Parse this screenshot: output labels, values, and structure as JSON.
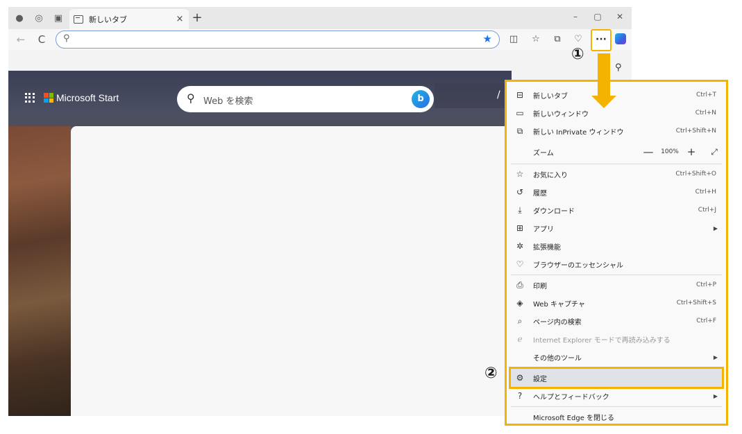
{
  "tab": {
    "label": "新しいタブ",
    "close": "×"
  },
  "tabbar": {
    "new_tab": "+",
    "minimize": "–",
    "restore": "▢",
    "close": "✕"
  },
  "toolbar": {
    "back": "←",
    "refresh": "C",
    "search_glyph": "⚲",
    "favorite_glyph": "★",
    "more_label": "···"
  },
  "content": {
    "brand_title": "Microsoft Start",
    "search_placeholder": "Web を検索",
    "bing_label": "b",
    "slash": "/"
  },
  "ms_colors": [
    "#f25022",
    "#7fba00",
    "#00a4ef",
    "#ffb900"
  ],
  "menu": {
    "new_tab": {
      "label": "新しいタブ",
      "shortcut": "Ctrl+T"
    },
    "new_window": {
      "label": "新しいウィンドウ",
      "shortcut": "Ctrl+N"
    },
    "new_inprivate": {
      "label": "新しい InPrivate ウィンドウ",
      "shortcut": "Ctrl+Shift+N"
    },
    "zoom": {
      "label": "ズーム",
      "minus": "—",
      "value": "100%",
      "plus": "+",
      "fullscreen": "⤢"
    },
    "favorites": {
      "label": "お気に入り",
      "shortcut": "Ctrl+Shift+O"
    },
    "history": {
      "label": "履歴",
      "shortcut": "Ctrl+H"
    },
    "downloads": {
      "label": "ダウンロード",
      "shortcut": "Ctrl+J"
    },
    "apps": {
      "label": "アプリ",
      "arrow": "▶"
    },
    "extensions": {
      "label": "拡張機能"
    },
    "essentials": {
      "label": "ブラウザーのエッセンシャル"
    },
    "print": {
      "label": "印刷",
      "shortcut": "Ctrl+P"
    },
    "web_capture": {
      "label": "Web キャプチャ",
      "shortcut": "Ctrl+Shift+S"
    },
    "find": {
      "label": "ページ内の検索",
      "shortcut": "Ctrl+F"
    },
    "ie_mode": {
      "label": "Internet Explorer モードで再読み込みする"
    },
    "more_tools": {
      "label": "その他のツール",
      "arrow": "▶"
    },
    "settings": {
      "label": "設定"
    },
    "help": {
      "label": "ヘルプとフィードバック",
      "arrow": "▶"
    },
    "close_edge": {
      "label": "Microsoft Edge を閉じる"
    }
  },
  "annotations": {
    "step1": "①",
    "step2": "②"
  },
  "highlight_color": "#f3b300"
}
